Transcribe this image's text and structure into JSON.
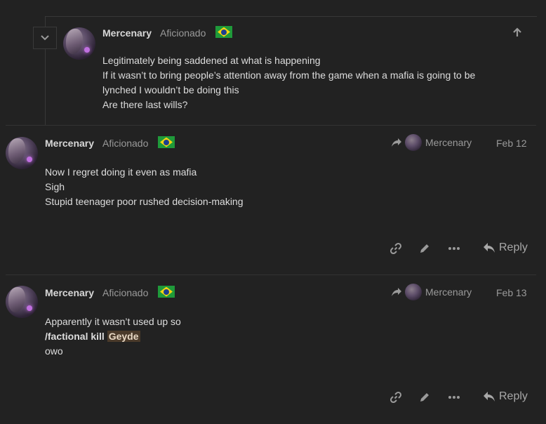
{
  "quoted_post": {
    "username": "Mercenary",
    "title": "Aficionado",
    "lines": [
      "Legitimately being saddened at what is happening",
      "If it wasn’t to bring people’s attention away from the game when a mafia is going to be",
      "lynched I wouldn’t be doing this",
      "Are there last wills?"
    ]
  },
  "posts": [
    {
      "username": "Mercenary",
      "title": "Aficionado",
      "reply_to": "Mercenary",
      "date": "Feb 12",
      "lines": [
        "Now I regret doing it even as mafia",
        "Sigh",
        "Stupid teenager poor rushed decision-making"
      ],
      "reply_label": "Reply"
    },
    {
      "username": "Mercenary",
      "title": "Aficionado",
      "reply_to": "Mercenary",
      "date": "Feb 13",
      "line1": "Apparently it wasn’t used up so",
      "command": "/factional kill",
      "target": "Geyde",
      "line3": "owo",
      "reply_label": "Reply"
    }
  ],
  "icons": {
    "collapse": "chevron-down-icon",
    "jump": "arrow-up-icon",
    "reply_to": "share-arrow-icon",
    "link": "link-icon",
    "edit": "pencil-icon",
    "more": "ellipsis-icon",
    "reply": "reply-icon"
  },
  "colors": {
    "background": "#222222",
    "flag_green": "#1f9a3a",
    "flag_yellow": "#f5d312",
    "flag_blue": "#1d3f8f",
    "mention_bg": "#4a3a2a"
  }
}
